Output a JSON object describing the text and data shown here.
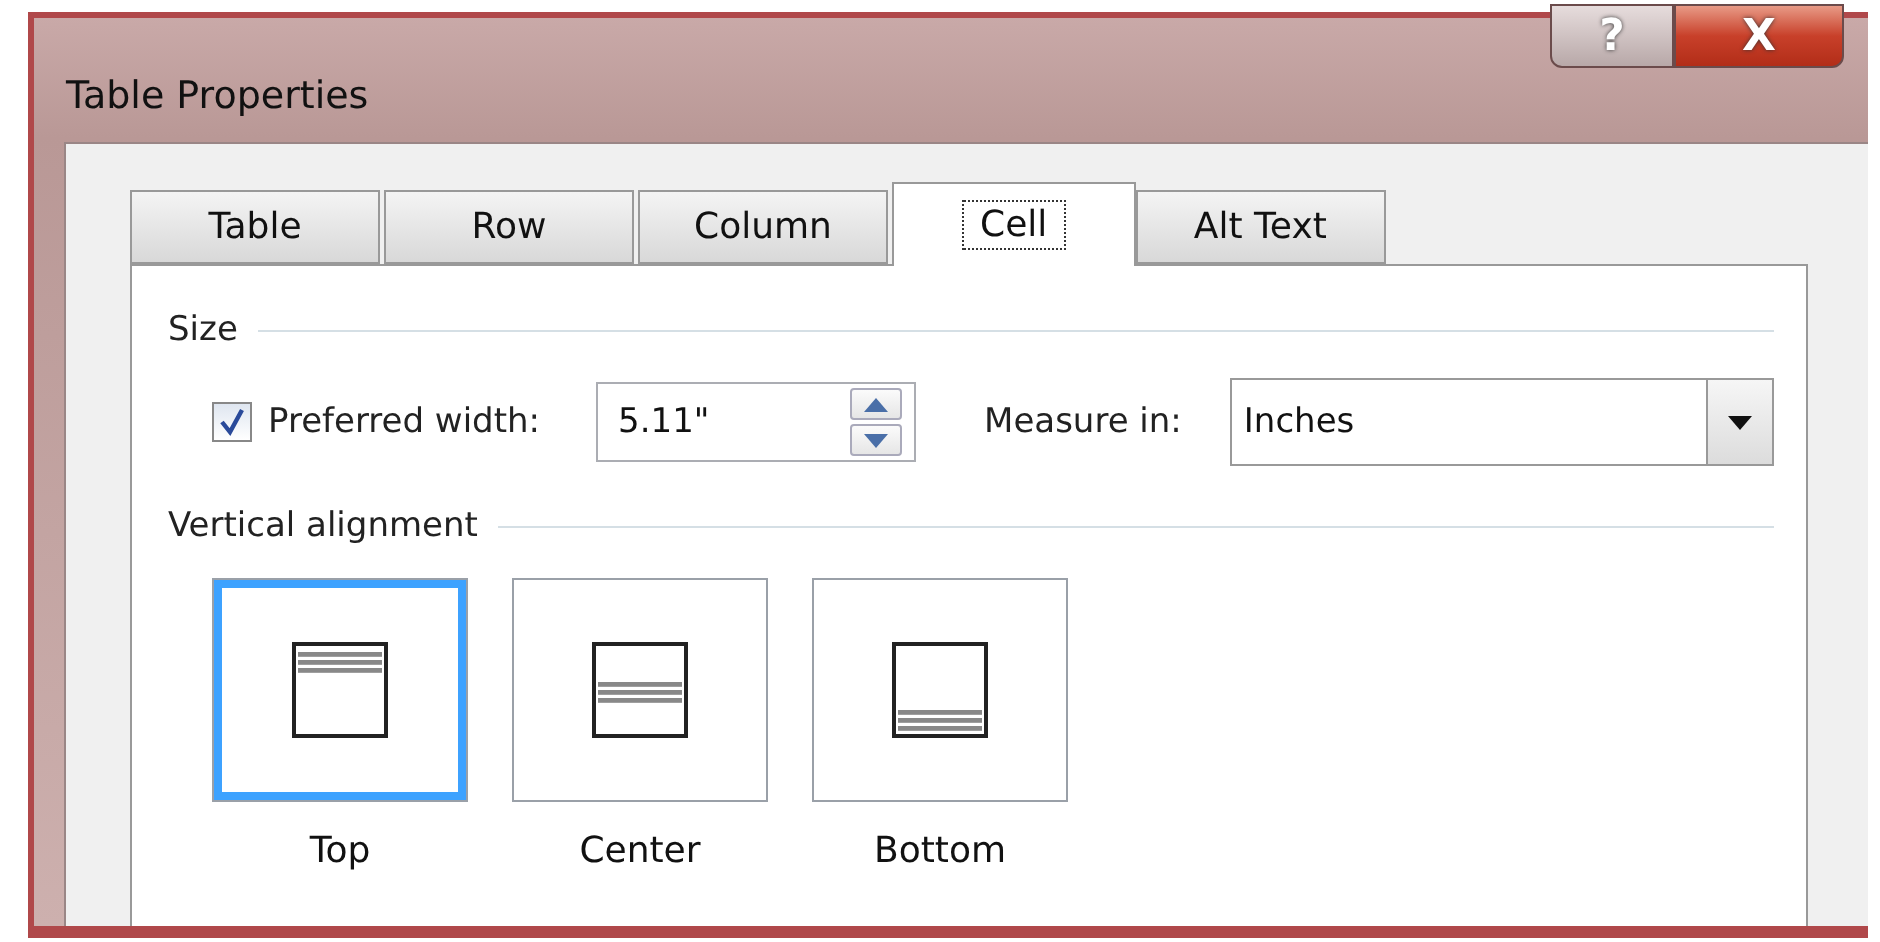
{
  "window": {
    "title": "Table Properties",
    "buttons": [
      {
        "kind": "help",
        "label": "?"
      },
      {
        "kind": "close",
        "label": "X"
      }
    ]
  },
  "tabs": [
    {
      "label": "Table",
      "selected": false
    },
    {
      "label": "Row",
      "selected": false
    },
    {
      "label": "Column",
      "selected": false
    },
    {
      "label": "Cell",
      "selected": true
    },
    {
      "label": "Alt Text",
      "selected": false
    }
  ],
  "size": {
    "heading": "Size",
    "preferred_width": {
      "label": "Preferred width:",
      "checked": true,
      "value": "5.11\""
    },
    "measure_in": {
      "label": "Measure in:",
      "value": "Inches"
    }
  },
  "vertical_alignment": {
    "heading": "Vertical alignment",
    "options": [
      {
        "kind": "top",
        "label": "Top",
        "selected": true
      },
      {
        "kind": "center",
        "label": "Center",
        "selected": false
      },
      {
        "kind": "bottom",
        "label": "Bottom",
        "selected": false
      }
    ]
  }
}
